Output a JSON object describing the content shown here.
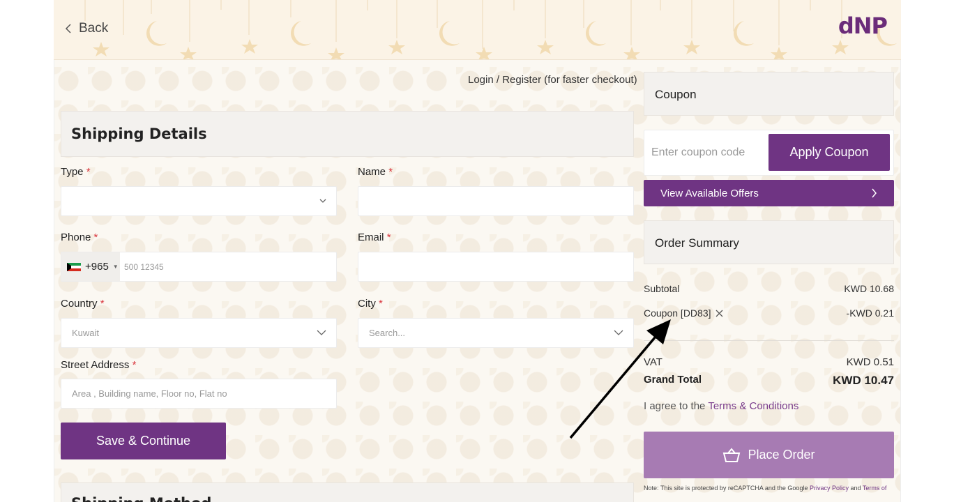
{
  "header": {
    "back_label": "Back",
    "logo_text": "dNP"
  },
  "login_link": "Login / Register (for faster checkout)",
  "shipping": {
    "title": "Shipping Details",
    "type": {
      "label": "Type",
      "value": ""
    },
    "name": {
      "label": "Name",
      "value": ""
    },
    "phone": {
      "label": "Phone",
      "country_code": "+965",
      "placeholder": "500 12345"
    },
    "email": {
      "label": "Email",
      "value": ""
    },
    "country": {
      "label": "Country",
      "value": "Kuwait"
    },
    "city": {
      "label": "City",
      "placeholder": "Search..."
    },
    "street": {
      "label": "Street Address",
      "placeholder": "Area , Building name, Floor no, Flat no"
    },
    "required_mark": "*",
    "save_button": "Save & Continue"
  },
  "shipping_method": {
    "title": "Shipping Method"
  },
  "coupon": {
    "title": "Coupon",
    "input_placeholder": "Enter coupon code",
    "apply_button": "Apply Coupon",
    "offers_button": "View Available Offers"
  },
  "order_summary": {
    "title": "Order Summary",
    "subtotal_label": "Subtotal",
    "subtotal_value": "KWD 10.68",
    "coupon_label": "Coupon [DD83]",
    "coupon_value": "-KWD 0.21",
    "vat_label": "VAT",
    "vat_value": "KWD 0.51",
    "grand_total_label": "Grand Total",
    "grand_total_value": "KWD 10.47",
    "agree_prefix": "I agree to the",
    "terms_link": "Terms & Conditions",
    "place_order_button": "Place Order",
    "note_prefix": "Note: This site is protected by reCAPTCHA and the Google",
    "privacy_link": "Privacy Policy",
    "note_and": "and",
    "terms_of_link": "Terms of"
  },
  "colors": {
    "brand_purple": "#6f3483",
    "place_order_disabled": "#a77bb3",
    "link_purple": "#7a3d8c",
    "required_red": "#d9363e"
  }
}
